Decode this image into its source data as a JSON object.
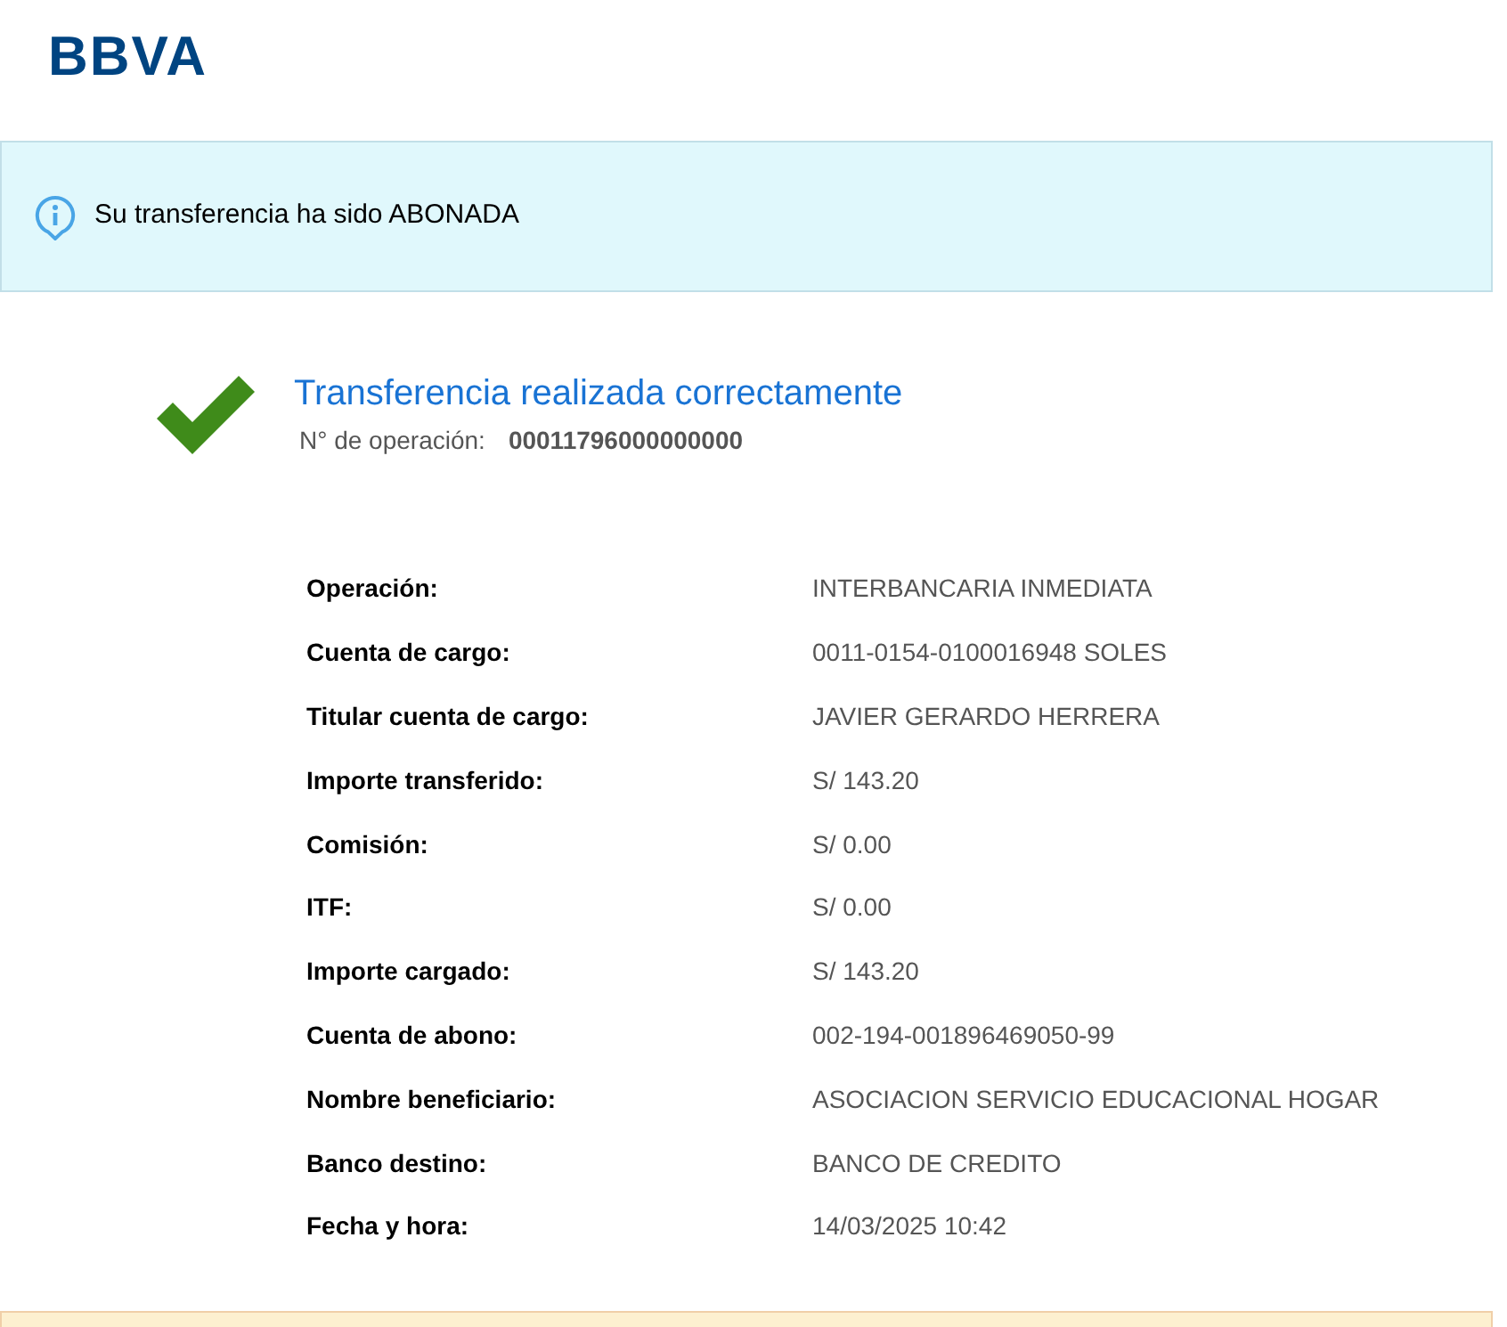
{
  "logo": "BBVA",
  "notice": {
    "text": "Su transferencia ha sido ABONADA"
  },
  "result": {
    "title": "Transferencia realizada correctamente",
    "operation_label": "N° de operación:",
    "operation_number": "00011796000000000"
  },
  "details": [
    {
      "label": "Operación:",
      "value": "INTERBANCARIA INMEDIATA"
    },
    {
      "label": "Cuenta de cargo:",
      "value": "0011-0154-0100016948 SOLES"
    },
    {
      "label": "Titular cuenta de cargo:",
      "value": "JAVIER GERARDO HERRERA"
    },
    {
      "label": "Importe transferido:",
      "value": "S/ 143.20"
    },
    {
      "label": "Comisión:",
      "value": "S/ 0.00"
    },
    {
      "label": "ITF:",
      "value": "S/ 0.00"
    },
    {
      "label": "Importe cargado:",
      "value": "S/ 143.20"
    },
    {
      "label": "Cuenta de abono:",
      "value": "002-194-001896469050-99"
    },
    {
      "label": "Nombre beneficiario:",
      "value": "ASOCIACION SERVICIO EDUCACIONAL HOGAR"
    },
    {
      "label": "Banco destino:",
      "value": "BANCO DE CREDITO"
    },
    {
      "label": "Fecha y hora:",
      "value": "14/03/2025 10:42"
    }
  ]
}
